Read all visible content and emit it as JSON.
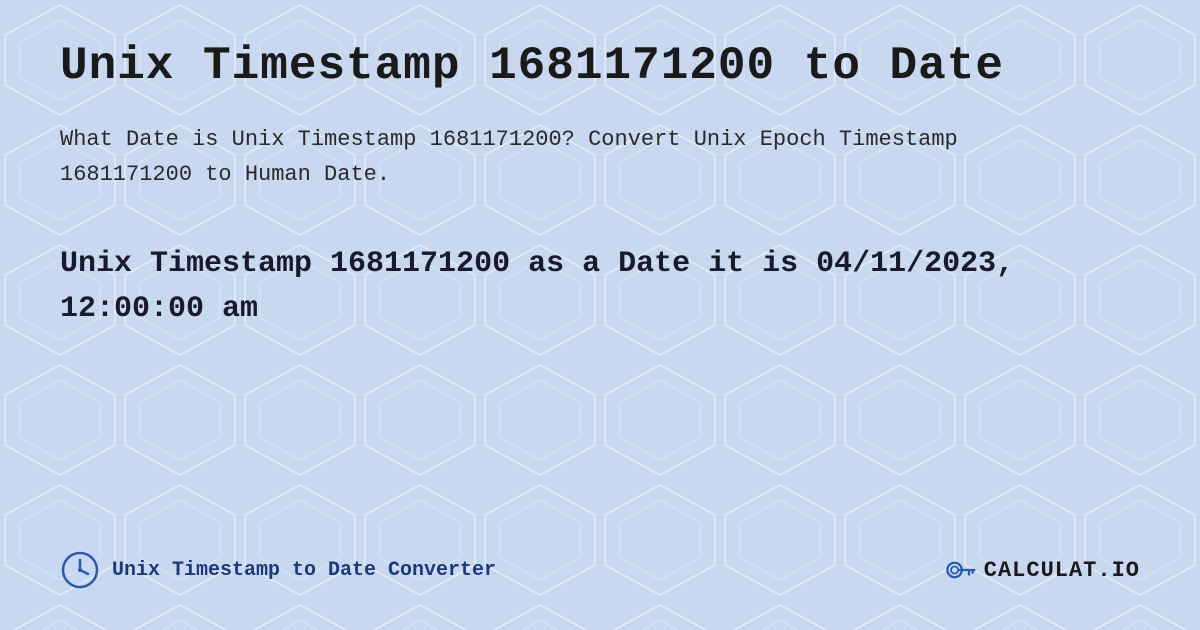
{
  "page": {
    "title": "Unix Timestamp 1681171200 to Date",
    "description": "What Date is Unix Timestamp 1681171200? Convert Unix Epoch Timestamp 1681171200 to Human Date.",
    "result": "Unix Timestamp 1681171200 as a Date it is 04/11/2023, 12:00:00 am",
    "background_color": "#c8d8f0"
  },
  "footer": {
    "link_text": "Unix Timestamp to Date Converter",
    "logo_text": "CALCULAT.IO"
  },
  "icons": {
    "clock": "clock-icon",
    "calculator": "calculator-icon"
  }
}
